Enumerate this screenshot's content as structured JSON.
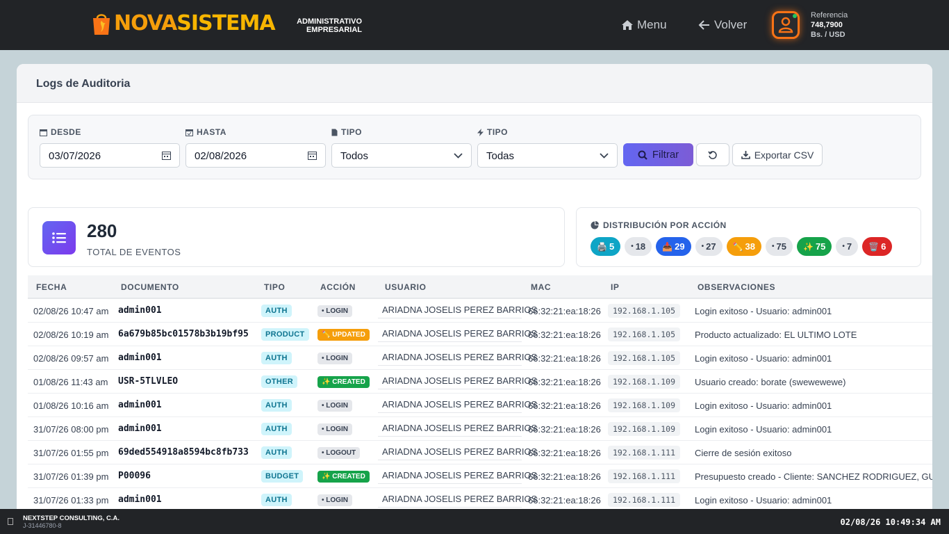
{
  "header": {
    "logo_part1": "NOVA",
    "logo_part2": "SISTEMA",
    "subtitle_line1": "ADMINISTRATIVO",
    "subtitle_line2": "EMPRESARIAL",
    "menu_label": "Menu",
    "back_label": "Volver",
    "reference_label": "Referencia",
    "reference_value": "748,7900",
    "reference_unit": "Bs. / USD"
  },
  "page": {
    "title": "Logs de Auditoria"
  },
  "filters": {
    "desde_label": "DESDE",
    "desde_value": "03/07/2026",
    "hasta_label": "HASTA",
    "hasta_value": "02/08/2026",
    "tipo_label": "TIPO",
    "tipo_value": "Todos",
    "tipo2_label": "TIPO",
    "tipo2_value": "Todas",
    "filter_button": "Filtrar",
    "export_button": "Exportar CSV"
  },
  "stats": {
    "total": "280",
    "total_label": "TOTAL DE EVENTOS",
    "distribution_title": "DISTRIBUCIÓN POR ACCIÓN",
    "pills": [
      {
        "icon": "🖨️",
        "value": "5",
        "bg": "#0ea5c6",
        "fg": "#ffffff"
      },
      {
        "icon": "•",
        "value": "18",
        "bg": "#e5e7eb",
        "fg": "#374151"
      },
      {
        "icon": "📥",
        "value": "29",
        "bg": "#2563eb",
        "fg": "#ffffff"
      },
      {
        "icon": "•",
        "value": "27",
        "bg": "#e5e7eb",
        "fg": "#374151"
      },
      {
        "icon": "✏️",
        "value": "38",
        "bg": "#f59e0b",
        "fg": "#ffffff"
      },
      {
        "icon": "•",
        "value": "75",
        "bg": "#e5e7eb",
        "fg": "#374151"
      },
      {
        "icon": "✨",
        "value": "75",
        "bg": "#16a34a",
        "fg": "#ffffff"
      },
      {
        "icon": "•",
        "value": "7",
        "bg": "#e5e7eb",
        "fg": "#374151"
      },
      {
        "icon": "🗑️",
        "value": "6",
        "bg": "#dc2626",
        "fg": "#ffffff"
      }
    ]
  },
  "table": {
    "headers": [
      "FECHA",
      "DOCUMENTO",
      "TIPO",
      "ACCIÓN",
      "USUARIO",
      "MAC",
      "IP",
      "OBSERVACIONES"
    ],
    "rows": [
      {
        "fecha": "02/08/26 10:47 am",
        "doc": "admin001",
        "tipo": "AUTH",
        "accion": "• LOGIN",
        "acc_kind": "login",
        "usuario": "ARIADNA JOSELIS PEREZ BARRIOS",
        "mac": "66:32:21:ea:18:26",
        "ip": "192.168.1.105",
        "obs": "Login exitoso - Usuario: admin001"
      },
      {
        "fecha": "02/08/26 10:19 am",
        "doc": "6a679b85bc01578b3b19bf95",
        "tipo": "PRODUCT",
        "accion": "✏️ UPDATED",
        "acc_kind": "upd",
        "usuario": "ARIADNA JOSELIS PEREZ BARRIOS",
        "mac": "66:32:21:ea:18:26",
        "ip": "192.168.1.105",
        "obs": "Producto actualizado: EL ULTIMO LOTE"
      },
      {
        "fecha": "02/08/26 09:57 am",
        "doc": "admin001",
        "tipo": "AUTH",
        "accion": "• LOGIN",
        "acc_kind": "login",
        "usuario": "ARIADNA JOSELIS PEREZ BARRIOS",
        "mac": "66:32:21:ea:18:26",
        "ip": "192.168.1.105",
        "obs": "Login exitoso - Usuario: admin001"
      },
      {
        "fecha": "01/08/26 11:43 am",
        "doc": "USR-5TLVLEO",
        "tipo": "OTHER",
        "accion": "✨ CREATED",
        "acc_kind": "crt",
        "usuario": "ARIADNA JOSELIS PEREZ BARRIOS",
        "mac": "66:32:21:ea:18:26",
        "ip": "192.168.1.109",
        "obs": "Usuario creado: borate (swewewewe)"
      },
      {
        "fecha": "01/08/26 10:16 am",
        "doc": "admin001",
        "tipo": "AUTH",
        "accion": "• LOGIN",
        "acc_kind": "login",
        "usuario": "ARIADNA JOSELIS PEREZ BARRIOS",
        "mac": "66:32:21:ea:18:26",
        "ip": "192.168.1.109",
        "obs": "Login exitoso - Usuario: admin001"
      },
      {
        "fecha": "31/07/26 08:00 pm",
        "doc": "admin001",
        "tipo": "AUTH",
        "accion": "• LOGIN",
        "acc_kind": "login",
        "usuario": "ARIADNA JOSELIS PEREZ BARRIOS",
        "mac": "66:32:21:ea:18:26",
        "ip": "192.168.1.109",
        "obs": "Login exitoso - Usuario: admin001"
      },
      {
        "fecha": "31/07/26 01:55 pm",
        "doc": "69ded554918a8594bc8fb733",
        "tipo": "AUTH",
        "accion": "• LOGOUT",
        "acc_kind": "login",
        "usuario": "ARIADNA JOSELIS PEREZ BARRIOS",
        "mac": "66:32:21:ea:18:26",
        "ip": "192.168.1.111",
        "obs": "Cierre de sesión exitoso"
      },
      {
        "fecha": "31/07/26 01:39 pm",
        "doc": "P00096",
        "tipo": "BUDGET",
        "accion": "✨ CREATED",
        "acc_kind": "crt",
        "usuario": "ARIADNA JOSELIS PEREZ BARRIOS",
        "mac": "66:32:21:ea:18:26",
        "ip": "192.168.1.111",
        "obs": "Presupuesto creado - Cliente: SANCHEZ RODRIGUEZ, GUIL"
      },
      {
        "fecha": "31/07/26 01:33 pm",
        "doc": "admin001",
        "tipo": "AUTH",
        "accion": "• LOGIN",
        "acc_kind": "login",
        "usuario": "ARIADNA JOSELIS PEREZ BARRIOS",
        "mac": "66:32:21:ea:18:26",
        "ip": "192.168.1.111",
        "obs": "Login exitoso - Usuario: admin001"
      }
    ]
  },
  "footer": {
    "company": "NEXTSTEP CONSULTING, C.A.",
    "rif": "J-31446780-8",
    "datetime": "02/08/26 10:49:34 AM"
  }
}
